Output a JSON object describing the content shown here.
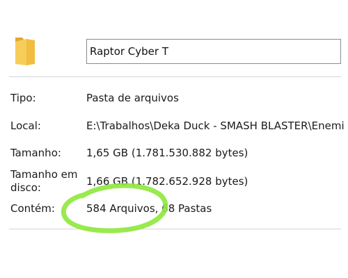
{
  "folder": {
    "icon": "folder-icon",
    "name": "Raptor Cyber T"
  },
  "properties": [
    {
      "label": "Tipo:",
      "value": "Pasta de arquivos"
    },
    {
      "label": "Local:",
      "value": "E:\\Trabalhos\\Deka Duck - SMASH BLASTER\\Enemi"
    },
    {
      "label": "Tamanho:",
      "value": "1,65 GB (1.781.530.882 bytes)"
    },
    {
      "label": "Tamanho em disco:",
      "value": "1,66 GB (1.782.652.928 bytes)"
    },
    {
      "label": "Contém:",
      "value": "584 Arquivos, 68 Pastas"
    }
  ],
  "colors": {
    "folder": "#f5c542",
    "highlight_circle": "#8ee83b"
  }
}
